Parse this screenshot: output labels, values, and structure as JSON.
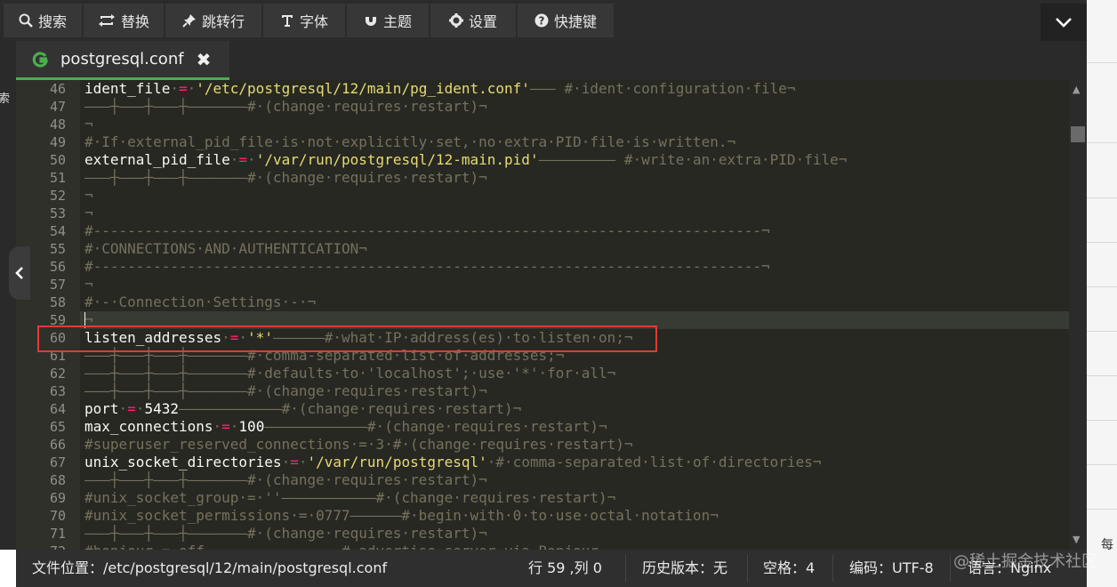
{
  "toolbar": {
    "buttons": [
      {
        "label": "搜索",
        "icon": "search-icon"
      },
      {
        "label": "替换",
        "icon": "replace-icon"
      },
      {
        "label": "跳转行",
        "icon": "pin-icon"
      },
      {
        "label": "字体",
        "icon": "font-icon"
      },
      {
        "label": "主题",
        "icon": "magnet-icon"
      },
      {
        "label": "设置",
        "icon": "gear-icon"
      },
      {
        "label": "快捷键",
        "icon": "help-icon"
      }
    ],
    "collapse_icon": "chevron-down-icon"
  },
  "tab": {
    "label": "postgresql.conf",
    "icon": "file-type-icon",
    "close": "✖"
  },
  "left_strip_text": "索",
  "editor": {
    "lines": [
      {
        "n": "46",
        "segs": [
          [
            "k",
            "ident_file"
          ],
          [
            "c",
            "·"
          ],
          [
            "o",
            "="
          ],
          [
            "c",
            "·"
          ],
          [
            "s",
            "'/etc/postgresql/12/main/pg_ident.conf'"
          ],
          [
            "c",
            "——— #·ident·configuration·file¬"
          ]
        ]
      },
      {
        "n": "47",
        "segs": [
          [
            "c",
            "———┼———┼———┼———————#·(change·requires·restart)¬"
          ]
        ]
      },
      {
        "n": "48",
        "segs": [
          [
            "c",
            "¬"
          ]
        ]
      },
      {
        "n": "49",
        "segs": [
          [
            "c",
            "#·If·external_pid_file·is·not·explicitly·set,·no·extra·PID·file·is·written.¬"
          ]
        ]
      },
      {
        "n": "50",
        "segs": [
          [
            "k",
            "external_pid_file"
          ],
          [
            "c",
            "·"
          ],
          [
            "o",
            "="
          ],
          [
            "c",
            "·"
          ],
          [
            "s",
            "'/var/run/postgresql/12-main.pid'"
          ],
          [
            "c",
            "————————— #·write·an·extra·PID·file¬"
          ]
        ]
      },
      {
        "n": "51",
        "segs": [
          [
            "c",
            "———┼———┼———┼———————#·(change·requires·restart)¬"
          ]
        ]
      },
      {
        "n": "52",
        "segs": [
          [
            "c",
            "¬"
          ]
        ]
      },
      {
        "n": "53",
        "segs": [
          [
            "c",
            "¬"
          ]
        ]
      },
      {
        "n": "54",
        "segs": [
          [
            "c",
            "#------------------------------------------------------------------------------¬"
          ]
        ]
      },
      {
        "n": "55",
        "segs": [
          [
            "c",
            "#·CONNECTIONS·AND·AUTHENTICATION¬"
          ]
        ]
      },
      {
        "n": "56",
        "segs": [
          [
            "c",
            "#------------------------------------------------------------------------------¬"
          ]
        ]
      },
      {
        "n": "57",
        "segs": [
          [
            "c",
            "¬"
          ]
        ]
      },
      {
        "n": "58",
        "segs": [
          [
            "c",
            "#·-·Connection·Settings·-·¬"
          ]
        ]
      },
      {
        "n": "59",
        "segs": [
          [
            "c",
            "¬"
          ]
        ]
      },
      {
        "n": "60",
        "segs": [
          [
            "k",
            "listen_addresses"
          ],
          [
            "c",
            "·"
          ],
          [
            "o",
            "="
          ],
          [
            "c",
            "·"
          ],
          [
            "s",
            "'*'"
          ],
          [
            "c",
            "——————#·what·IP·address(es)·to·listen·on;¬"
          ]
        ]
      },
      {
        "n": "61",
        "segs": [
          [
            "c",
            "———┼———┼———┼———————#·comma-separated·list·of·addresses;¬"
          ]
        ]
      },
      {
        "n": "62",
        "segs": [
          [
            "c",
            "———┼———┼———┼———————#·defaults·to·'localhost';·use·'*'·for·all¬"
          ]
        ]
      },
      {
        "n": "63",
        "segs": [
          [
            "c",
            "———┼———┼———┼———————#·(change·requires·restart)¬"
          ]
        ]
      },
      {
        "n": "64",
        "segs": [
          [
            "k",
            "port"
          ],
          [
            "c",
            "·"
          ],
          [
            "o",
            "="
          ],
          [
            "c",
            "·"
          ],
          [
            "n",
            "5432"
          ],
          [
            "c",
            "————————————#·(change·requires·restart)¬"
          ]
        ]
      },
      {
        "n": "65",
        "segs": [
          [
            "k",
            "max_connections"
          ],
          [
            "c",
            "·"
          ],
          [
            "o",
            "="
          ],
          [
            "c",
            "·"
          ],
          [
            "n",
            "100"
          ],
          [
            "c",
            "————————————#·(change·requires·restart)¬"
          ]
        ]
      },
      {
        "n": "66",
        "segs": [
          [
            "c",
            "#superuser_reserved_connections·=·3·#·(change·requires·restart)¬"
          ]
        ]
      },
      {
        "n": "67",
        "segs": [
          [
            "k",
            "unix_socket_directories"
          ],
          [
            "c",
            "·"
          ],
          [
            "o",
            "="
          ],
          [
            "c",
            "·"
          ],
          [
            "s",
            "'/var/run/postgresql'"
          ],
          [
            "c",
            "·#·comma-separated·list·of·directories¬"
          ]
        ]
      },
      {
        "n": "68",
        "segs": [
          [
            "c",
            "———┼———┼———┼———————#·(change·requires·restart)¬"
          ]
        ]
      },
      {
        "n": "69",
        "segs": [
          [
            "c",
            "#unix_socket_group·=·''———————————#·(change·requires·restart)¬"
          ]
        ]
      },
      {
        "n": "70",
        "segs": [
          [
            "c",
            "#unix_socket_permissions·=·0777——————#·begin·with·0·to·use·octal·notation¬"
          ]
        ]
      },
      {
        "n": "71",
        "segs": [
          [
            "c",
            "———┼———┼———┼———————#·(change·requires·restart)¬"
          ]
        ]
      },
      {
        "n": "72",
        "segs": [
          [
            "c",
            "#bonjour·=·off————————————————#·advertise·server·via·Bonjour¬"
          ]
        ]
      }
    ]
  },
  "status": {
    "file_path": "文件位置：/etc/postgresql/12/main/postgresql.conf",
    "cursor": "行 59 ,列 0",
    "history": "历史版本：无",
    "indent": "空格：4",
    "encoding": "编码：UTF-8",
    "language": "语言：Nginx"
  },
  "watermark": "@稀土掘金技术社区",
  "right_panel_text": "每"
}
